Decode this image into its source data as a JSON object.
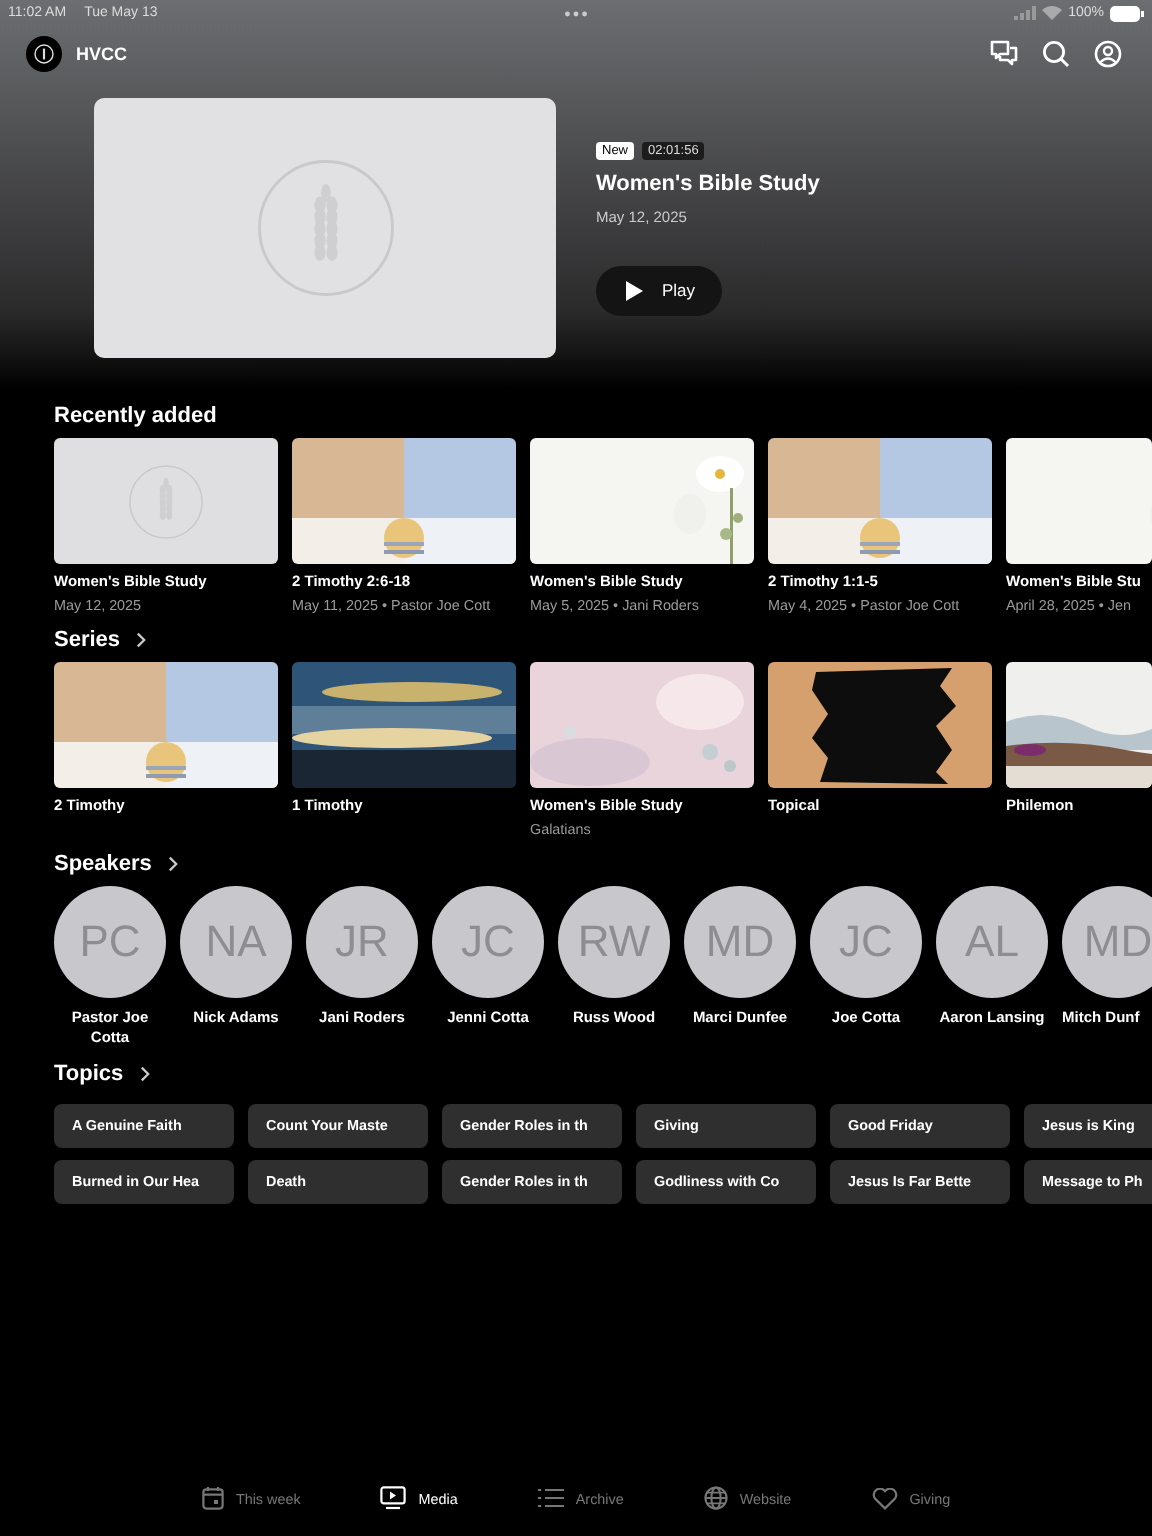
{
  "status_bar": {
    "time": "11:02 AM",
    "date": "Tue May 13",
    "battery": "100%"
  },
  "header": {
    "title": "HVCC"
  },
  "featured": {
    "thumbnail": {
      "kind": "placeholder"
    },
    "badge": "New",
    "duration": "02:01:56",
    "title": "Women's Bible Study",
    "date": "May 12, 2025",
    "play_button": "Play"
  },
  "recently_added": {
    "heading": "Recently added",
    "items": [
      {
        "kind": "placeholder",
        "title": "Women's Bible Study",
        "subtitle": "May 12, 2025"
      },
      {
        "kind": "picture",
        "title": "2 Timothy 2:6-18",
        "subtitle": "May 11, 2025 • Pastor Joe Cott"
      },
      {
        "kind": "picture",
        "title": "Women's Bible Study",
        "subtitle": "May 5, 2025 • Jani Roders"
      },
      {
        "kind": "picture",
        "title": "2 Timothy 1:1-5",
        "subtitle": "May 4, 2025 • Pastor Joe Cott"
      },
      {
        "kind": "picture",
        "title": "Women's Bible Stu",
        "subtitle": "April 28, 2025 • Jen"
      }
    ]
  },
  "series": {
    "heading": "Series",
    "items": [
      {
        "kind": "picture",
        "title": "2 Timothy"
      },
      {
        "kind": "picture",
        "title": "1 Timothy"
      },
      {
        "kind": "picture",
        "title": "Women's Bible Study",
        "subtitle": "Galatians"
      },
      {
        "kind": "picture",
        "title": "Topical"
      },
      {
        "kind": "picture",
        "title": "Philemon"
      }
    ]
  },
  "speakers": {
    "heading": "Speakers",
    "items": [
      {
        "initials": "PC",
        "name": "Pastor Joe Cotta"
      },
      {
        "initials": "NA",
        "name": "Nick Adams"
      },
      {
        "initials": "JR",
        "name": "Jani Roders"
      },
      {
        "initials": "JC",
        "name": "Jenni Cotta"
      },
      {
        "initials": "RW",
        "name": "Russ Wood"
      },
      {
        "initials": "MD",
        "name": "Marci Dunfee"
      },
      {
        "initials": "JC",
        "name": "Joe Cotta"
      },
      {
        "initials": "AL",
        "name": "Aaron Lansing"
      },
      {
        "initials": "MD",
        "name": "Mitch Dunf"
      }
    ]
  },
  "topics": {
    "heading": "Topics",
    "rows": [
      [
        "A Genuine Faith",
        "Count Your Maste",
        "Gender Roles in th",
        "Giving",
        "Good Friday",
        "Jesus is King"
      ],
      [
        "Burned in Our Hea",
        "Death",
        "Gender Roles in th",
        "Godliness with Co",
        "Jesus Is Far Bette",
        "Message to Ph"
      ]
    ]
  },
  "tab_bar": [
    {
      "kind": "calendar",
      "label": "This week",
      "selected": false
    },
    {
      "kind": "media",
      "label": "Media",
      "selected": true
    },
    {
      "kind": "list",
      "label": "Archive",
      "selected": false
    },
    {
      "kind": "globe",
      "label": "Website",
      "selected": false
    },
    {
      "kind": "heart",
      "label": "Giving",
      "selected": false
    }
  ]
}
